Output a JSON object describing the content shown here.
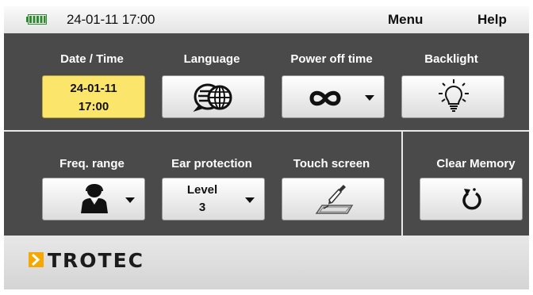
{
  "status": {
    "datetime": "24-01-11 17:00",
    "menu_label": "Menu",
    "help_label": "Help",
    "battery_icon": "battery-full-icon"
  },
  "settings": {
    "date_time": {
      "label": "Date / Time",
      "date": "24-01-11",
      "time": "17:00",
      "highlight_color": "#fbe66b"
    },
    "language": {
      "label": "Language",
      "icon": "language-globe-icon"
    },
    "power_off": {
      "label": "Power off time",
      "value_symbol": "∞",
      "icon": "infinity-icon"
    },
    "backlight": {
      "label": "Backlight",
      "icon": "lightbulb-icon"
    },
    "freq_range": {
      "label": "Freq. range",
      "icon": "person-icon"
    },
    "ear_protection": {
      "label": "Ear protection",
      "level_label": "Level",
      "level_value": "3"
    },
    "touch_screen": {
      "label": "Touch screen",
      "icon": "pen-tablet-icon"
    },
    "clear_memory": {
      "label": "Clear Memory",
      "icon": "reset-icon"
    }
  },
  "footer": {
    "brand": "TROTEC",
    "brand_color": "#f5a800"
  },
  "colors": {
    "panel": "#4a4a4a",
    "date_highlight": "#fbe66b"
  }
}
